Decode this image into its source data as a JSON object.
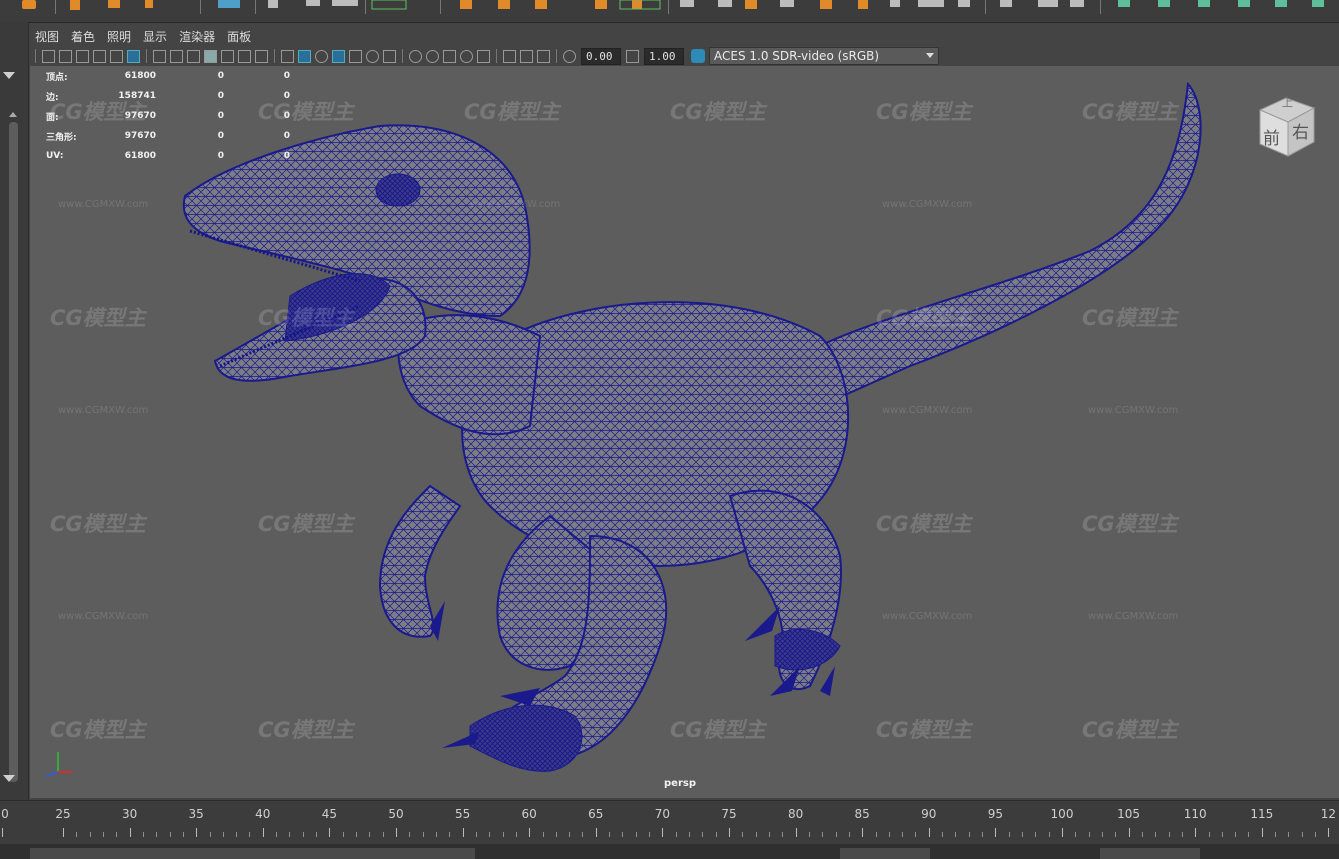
{
  "panel_menu": [
    "视图",
    "着色",
    "照明",
    "显示",
    "渲染器",
    "面板"
  ],
  "toolbar": {
    "exposure_value": "0.00",
    "gamma_value": "1.00",
    "color_space": "ACES 1.0 SDR-video (sRGB)"
  },
  "hud": [
    {
      "label": "顶点:",
      "v1": "61800",
      "v2": "0",
      "v3": "0"
    },
    {
      "label": "边:",
      "v1": "158741",
      "v2": "0",
      "v3": "0"
    },
    {
      "label": "面:",
      "v1": "97670",
      "v2": "0",
      "v3": "0"
    },
    {
      "label": "三角形:",
      "v1": "97670",
      "v2": "0",
      "v3": "0"
    },
    {
      "label": "UV:",
      "v1": "61800",
      "v2": "0",
      "v3": "0"
    }
  ],
  "viewport": {
    "camera_label": "persp",
    "viewcube_front": "前",
    "viewcube_right": "右",
    "viewcube_top": "上",
    "mesh_wire_color": "#1a1a8c",
    "background_color": "#5d5d5d"
  },
  "watermark": {
    "logo_text": "CG模型主",
    "url_text": "www.CGMXW.com"
  },
  "timeline": {
    "ticks": [
      "0",
      "25",
      "30",
      "35",
      "40",
      "45",
      "50",
      "55",
      "60",
      "65",
      "70",
      "75",
      "80",
      "85",
      "90",
      "95",
      "100",
      "105",
      "110",
      "115",
      "12"
    ]
  }
}
